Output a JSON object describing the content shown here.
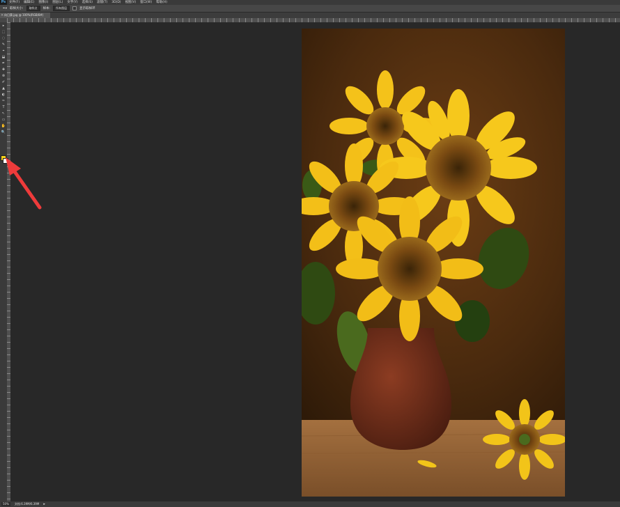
{
  "app": {
    "logo": "Ps",
    "menu": [
      "文件(F)",
      "编辑(E)",
      "图像(I)",
      "图层(L)",
      "文字(Y)",
      "选择(S)",
      "滤镜(T)",
      "3D(D)",
      "视图(V)",
      "窗口(W)",
      "帮助(H)"
    ]
  },
  "options": {
    "size_label": "取样大小:",
    "size_value": "取样点",
    "sample_label": "样本:",
    "sample_value": "所有图层",
    "show_ring_label": "显示取样环"
  },
  "document": {
    "tab_title": "向日葵.jpg @ 100%(RGB/8#)"
  },
  "toolbox": {
    "tools": [
      "▸",
      "⬚",
      "◌",
      "✎",
      "⌖",
      "⬓",
      "✒",
      "✚",
      "⊗",
      "✐",
      "▲",
      "◐",
      "✑",
      "T",
      "↖",
      "▭",
      "✋",
      "🔍"
    ],
    "foreground_color": "#f5d21a",
    "background_color": "#ffffff"
  },
  "status": {
    "zoom": "50%",
    "doc_info": "文档:6.39M/6.39M"
  },
  "colors": {
    "arrow": "#ee3b3b"
  }
}
